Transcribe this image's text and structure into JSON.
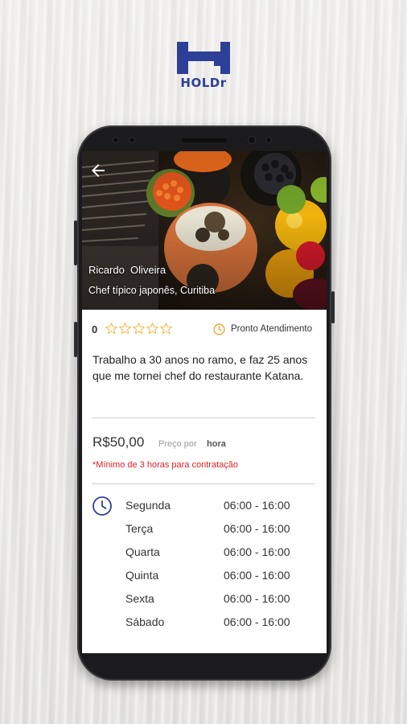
{
  "brand": {
    "name": "HOLDr",
    "color": "#2d3f97"
  },
  "header": {
    "back_icon": "arrow-left-icon",
    "chef_name": "Ricardo  Oliveira",
    "chef_subtitle": "Chef típico japonês, Curitiba"
  },
  "rating": {
    "value": "0",
    "stars_max": 5,
    "stars_filled": 0,
    "star_color": "#f2b233",
    "status_icon": "clock-icon",
    "status_text": "Pronto Atendimento"
  },
  "bio": "Trabalho a 30 anos no ramo, e faz 25 anos que me tornei chef do restaurante Katana.",
  "pricing": {
    "price": "R$50,00",
    "per_label": "Preço por",
    "unit": "hora",
    "minimum_note": "*Mínimo de 3 horas para contratação",
    "note_color": "#e02020"
  },
  "schedule": {
    "icon": "clock-icon",
    "icon_color": "#2d3f97",
    "rows": [
      {
        "day": "Segunda",
        "time": "06:00 - 16:00"
      },
      {
        "day": "Terça",
        "time": "06:00 - 16:00"
      },
      {
        "day": "Quarta",
        "time": "06:00 - 16:00"
      },
      {
        "day": "Quinta",
        "time": "06:00 - 16:00"
      },
      {
        "day": "Sexta",
        "time": "06:00 - 16:00"
      },
      {
        "day": "Sábado",
        "time": "06:00 - 16:00"
      }
    ]
  }
}
